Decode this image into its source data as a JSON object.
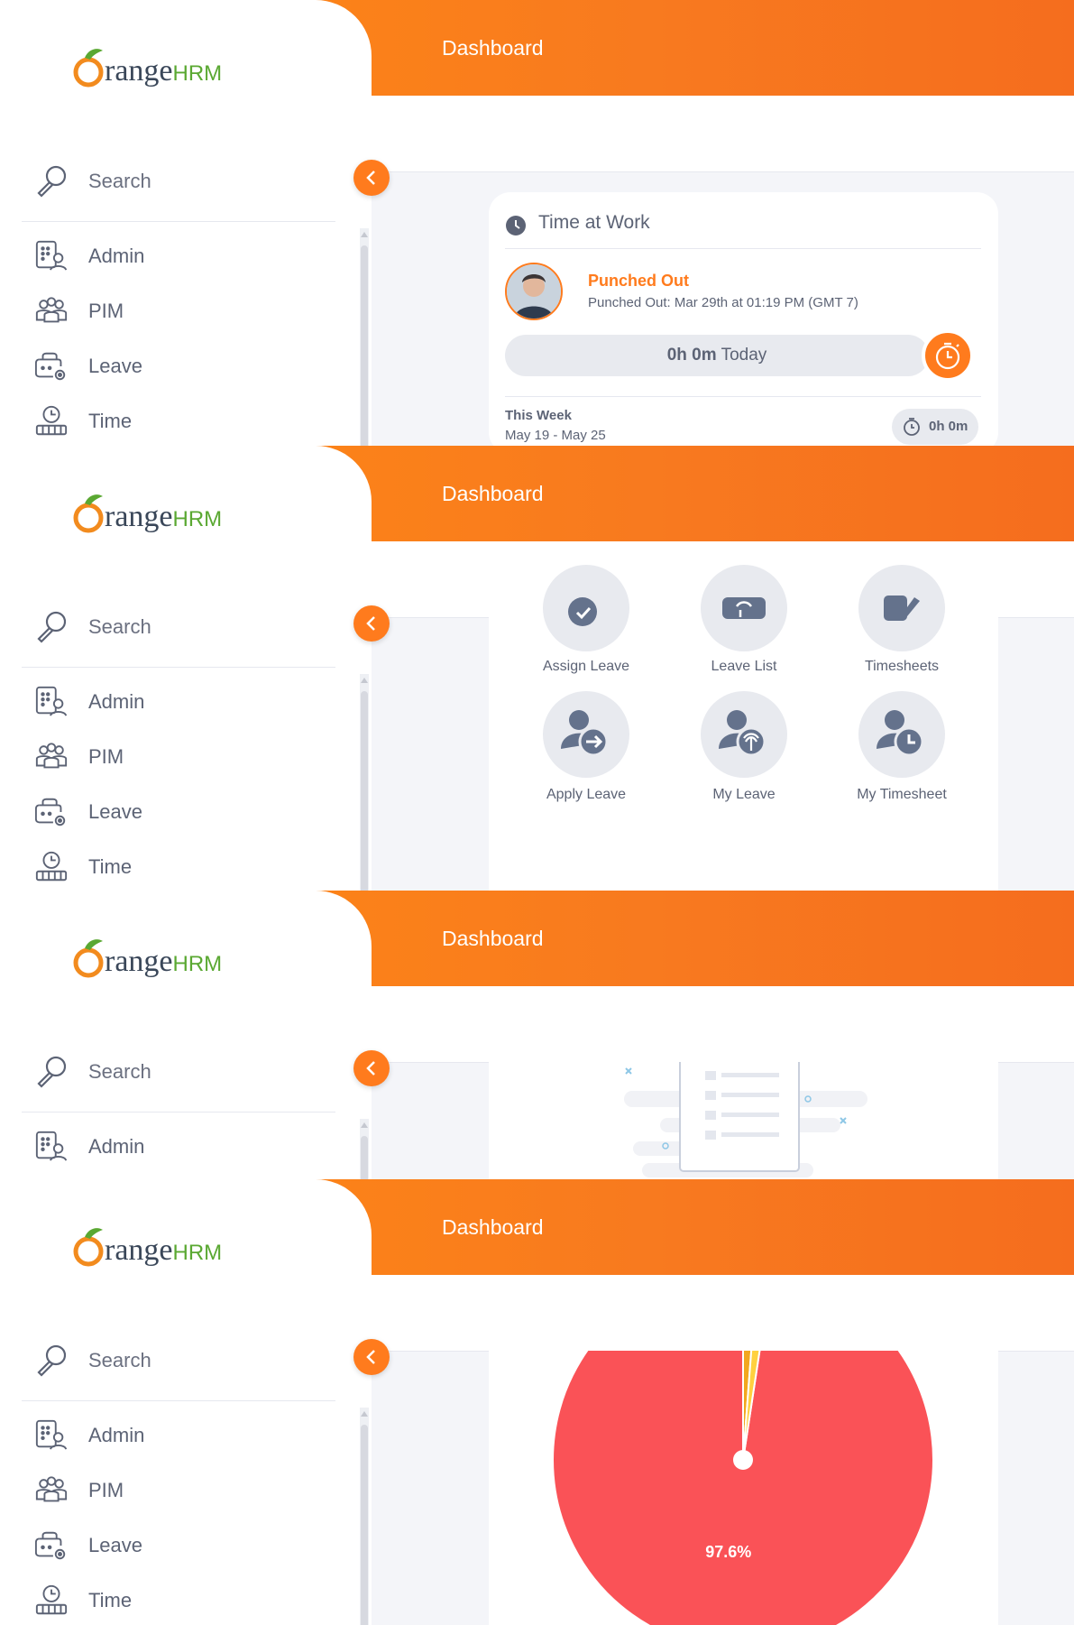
{
  "app": {
    "brand_prefix": "range",
    "brand_suffix": "HRM",
    "page_title": "Dashboard"
  },
  "sidebar": {
    "search_label": "Search",
    "items": [
      {
        "label": "Admin",
        "icon": "admin-icon"
      },
      {
        "label": "PIM",
        "icon": "pim-icon"
      },
      {
        "label": "Leave",
        "icon": "leave-icon"
      },
      {
        "label": "Time",
        "icon": "time-icon"
      }
    ]
  },
  "time_at_work": {
    "title": "Time at Work",
    "status": "Punched Out",
    "status_detail": "Punched Out: Mar 29th at 01:19 PM (GMT 7)",
    "today_bold": "0h 0m",
    "today_suffix": "Today",
    "week_label": "This Week",
    "week_range": "May 19 - May 25",
    "week_total": "0h 0m"
  },
  "quick_launch": {
    "row1": [
      "Assign Leave",
      "Leave List",
      "Timesheets"
    ],
    "row2": [
      {
        "label": "Apply Leave",
        "icon": "apply-leave-icon"
      },
      {
        "label": "My Leave",
        "icon": "my-leave-icon"
      },
      {
        "label": "My Timesheet",
        "icon": "my-timesheet-icon"
      }
    ]
  },
  "chart_data": {
    "type": "pie",
    "slices": [
      {
        "label": "97.6%",
        "value": 97.6,
        "color": "#fa5257"
      },
      {
        "label": "",
        "value": 1.2,
        "color": "#f2a71e"
      },
      {
        "label": "",
        "value": 1.2,
        "color": "#ffd13f"
      }
    ]
  },
  "colors": {
    "accent": "#ff7b1d",
    "pie_main": "#fa5257",
    "text": "#5c6375"
  }
}
